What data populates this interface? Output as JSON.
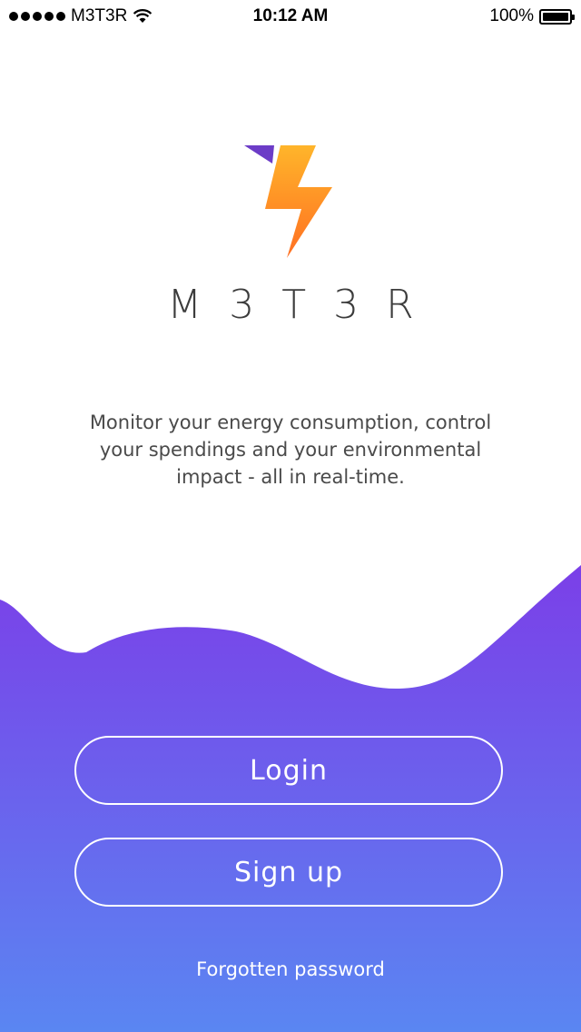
{
  "status_bar": {
    "carrier": "M3T3R",
    "time": "10:12 AM",
    "battery": "100%",
    "icons": [
      "signal-dots-icon",
      "wifi-icon",
      "battery-icon"
    ]
  },
  "brand": {
    "logo_icon": "lightning-bolt-icon",
    "name": "M3T3R"
  },
  "tagline": "Monitor your energy consumption, control your spendings and your environmental impact - all in real-time.",
  "actions": {
    "login_label": "Login",
    "signup_label": "Sign up",
    "forgot_label": "Forgotten password"
  },
  "colors": {
    "gradient_top": "#7b3fe8",
    "gradient_bottom": "#5a86f2",
    "bolt_top": "#ffb52a",
    "bolt_bottom": "#ff6f22",
    "accent_purple": "#6c3cc7"
  }
}
